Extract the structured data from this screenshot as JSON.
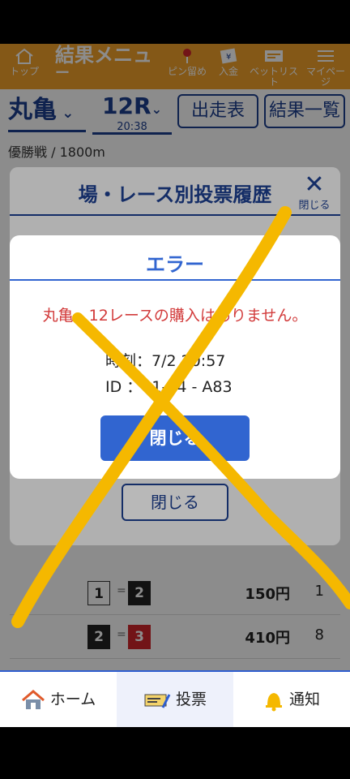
{
  "header": {
    "top_label": "トップ",
    "title_line1": "結果メニュ",
    "title_line2": "ー",
    "pin_label": "ピン留め",
    "deposit_label": "入金",
    "betlist_label": "ベットリスト",
    "mypage_label": "マイページ"
  },
  "race_selector": {
    "venue": "丸亀",
    "race": "12R",
    "time": "20:38",
    "entry_button": "出走表",
    "results_button": "結果一覧"
  },
  "subtitle": {
    "race_name": "優勝戦",
    "distance": "1800m"
  },
  "background_rows": [
    {
      "first": "1",
      "second": "2",
      "yen": "150円",
      "count": "1"
    },
    {
      "first": "2",
      "second": "3",
      "yen": "410円",
      "count": "8"
    }
  ],
  "history_panel": {
    "title": "場・レース別投票履歴",
    "close_top": "閉じる",
    "close_button": "閉じる"
  },
  "error_dialog": {
    "title": "エラー",
    "message": "丸亀、12レースの購入はありません。",
    "time_line": "時刻：7/2 20:57",
    "id_line": "ID ：01-94 - A83",
    "close_button": "閉じる"
  },
  "bottom_nav": {
    "home": "ホーム",
    "vote": "投票",
    "notify": "通知"
  },
  "colors": {
    "header": "#f0a12a",
    "brand_blue": "#1d3f8f",
    "dialog_blue": "#3165d0",
    "error_red": "#d23b3b",
    "mark_yellow": "#f5b800"
  }
}
